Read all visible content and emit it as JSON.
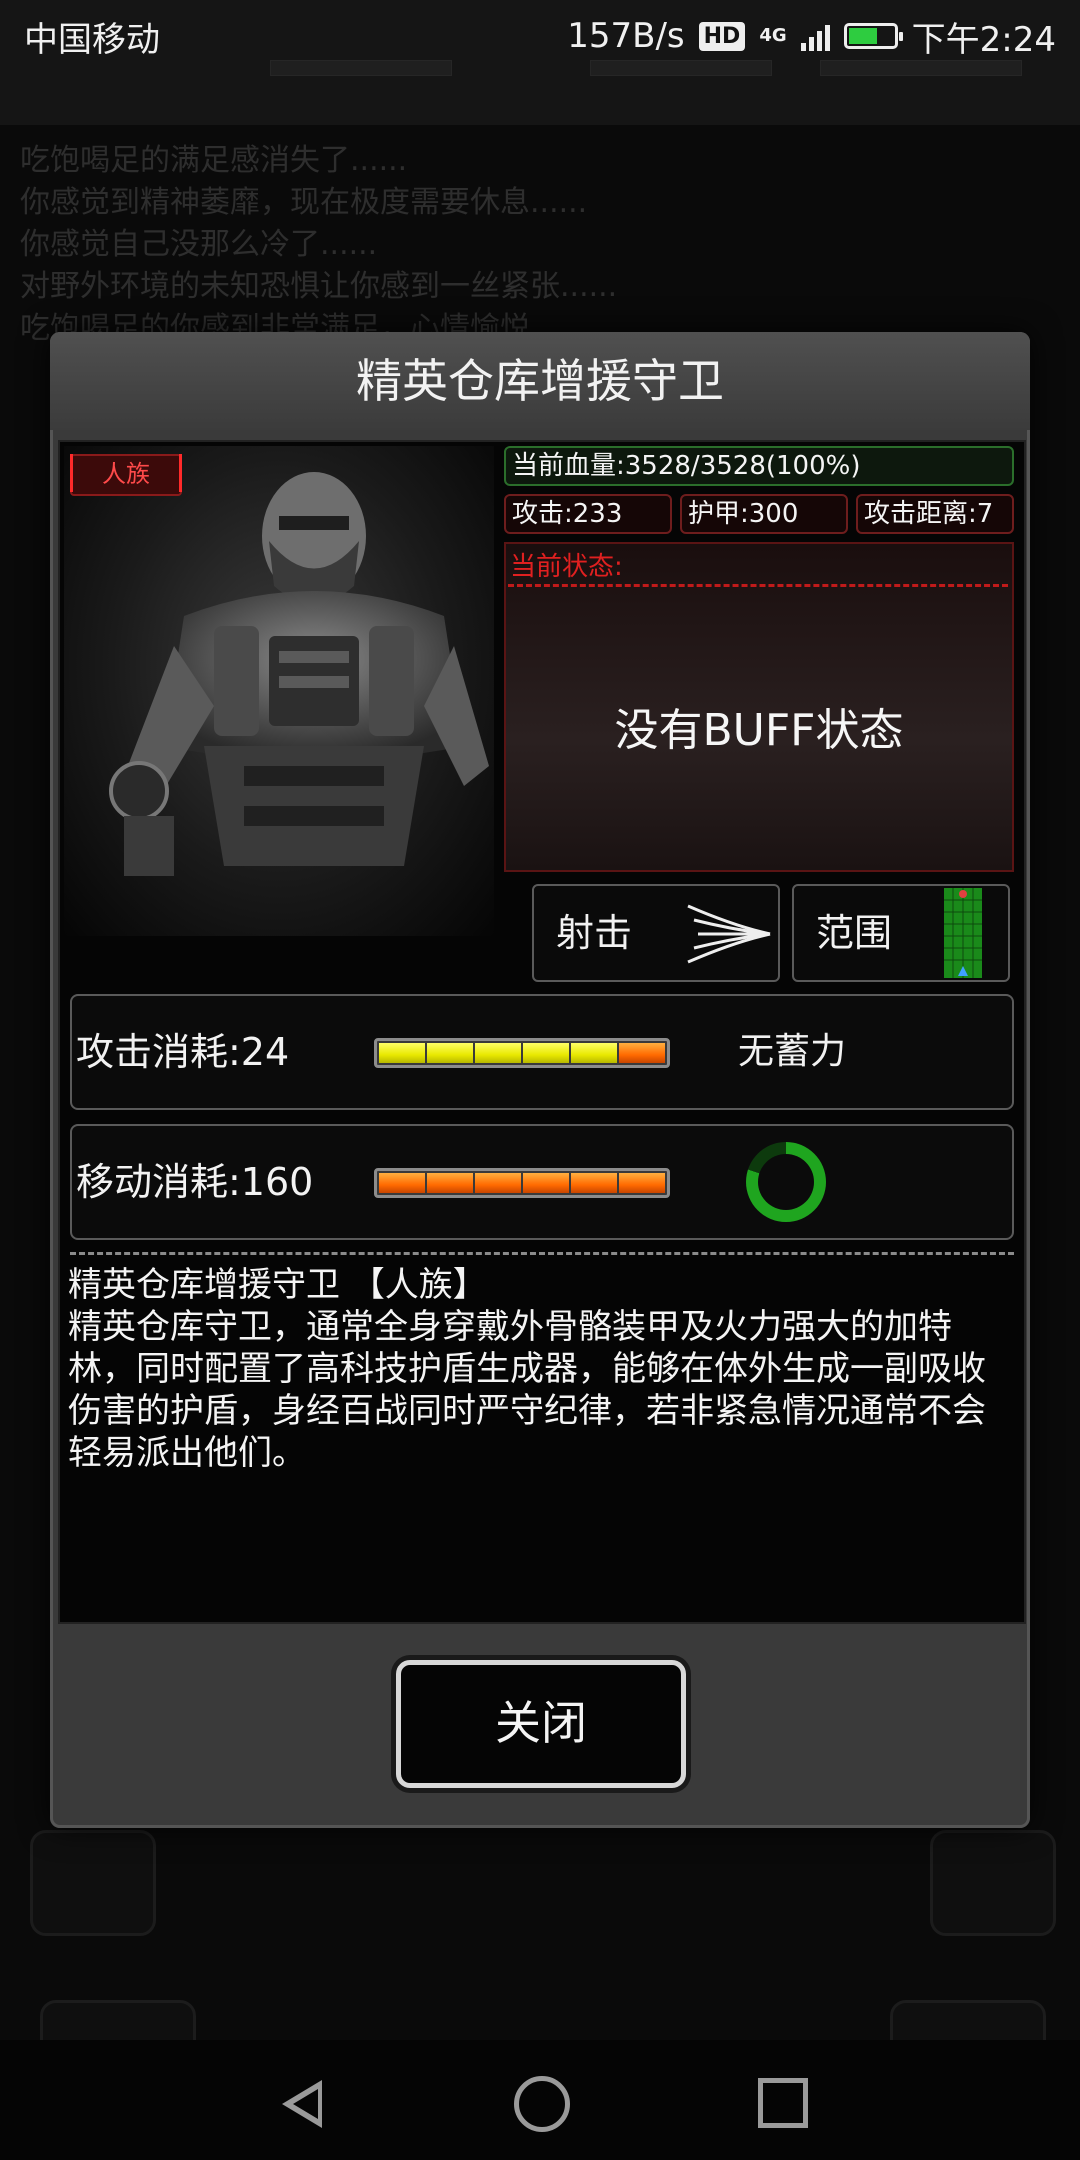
{
  "status_bar": {
    "carrier": "中国移动",
    "net_speed": "157B/s",
    "hd": "HD",
    "network": "4G",
    "time": "下午2:24"
  },
  "dialog": {
    "title": "精英仓库增援守卫",
    "race_tag": "人族",
    "hp": "当前血量:3528/3528(100%)",
    "attack": "攻击:233",
    "armor": "护甲:300",
    "range": "攻击距离:7",
    "status_label": "当前状态:",
    "status_text": "没有BUFF状态",
    "mode_shoot": "射击",
    "mode_range": "范围",
    "attack_cost": {
      "label": "攻击消耗:24",
      "fill_fraction": 0.85,
      "note": "无蓄力"
    },
    "move_cost": {
      "label": "移动消耗:160",
      "fill_fraction": 1.0,
      "cooldown_fraction": 0.8
    },
    "description_title": "精英仓库增援守卫 【人族】",
    "description_body": "精英仓库守卫，通常全身穿戴外骨骼装甲及火力强大的加特林，同时配置了高科技护盾生成器，能够在体外生成一副吸收伤害的护盾，身经百战同时严守纪律，若非紧急情况通常不会轻易派出他们。",
    "close_label": "关闭"
  },
  "background_log": [
    "吃饱喝足的满足感消失了......",
    "你感觉到精神萎靡，现在极度需要休息......",
    "你感觉自己没那么冷了......",
    "对野外环境的未知恐惧让你感到一丝紧张......",
    "吃饱喝足的你感到非常满足，心情愉悦......"
  ],
  "colors": {
    "hp_border": "#2b6e2b",
    "stat_border": "#6e1d1d",
    "status_red": "#e02020",
    "bar_yellow": "#e8e800",
    "bar_orange": "#ff6a00",
    "cooldown_green": "#1fa51f"
  }
}
